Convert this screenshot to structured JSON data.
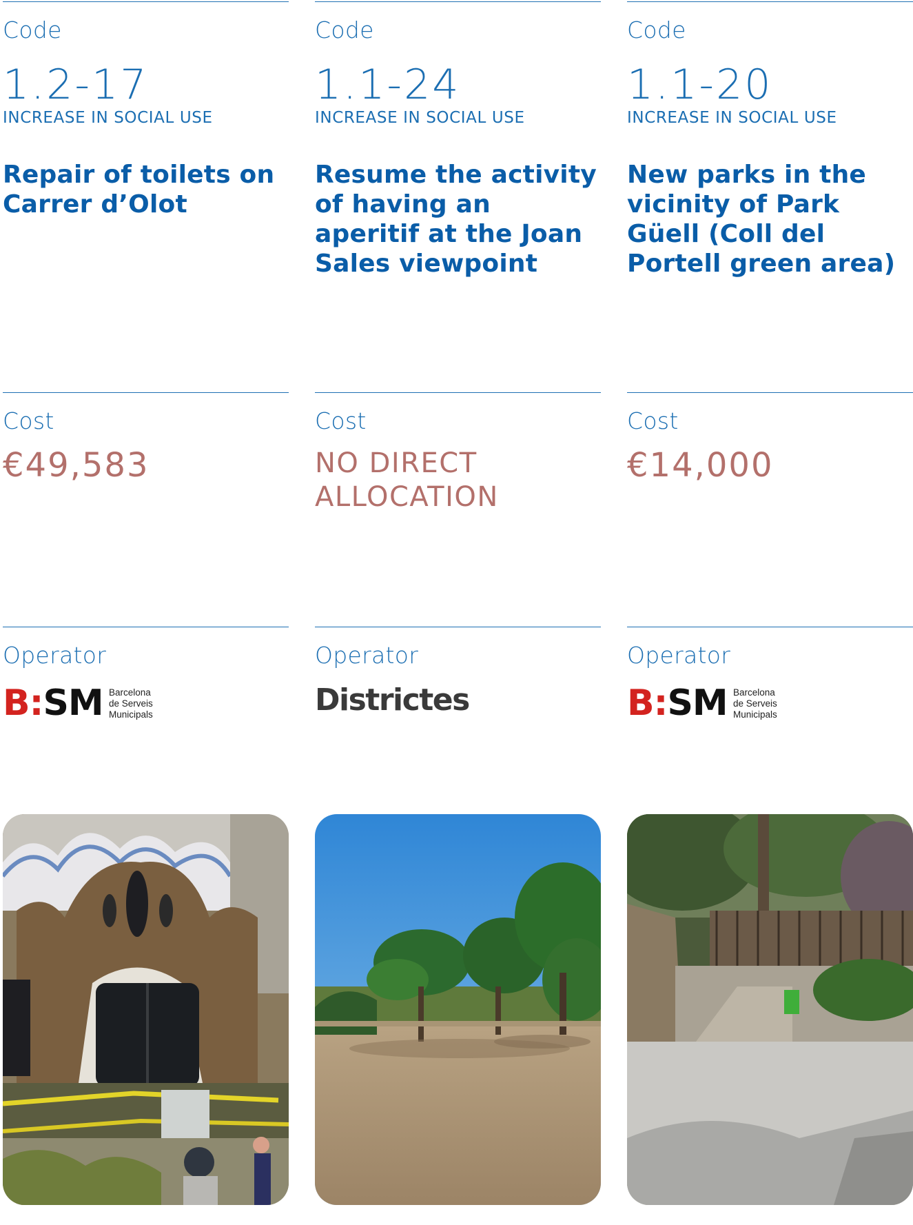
{
  "labels": {
    "code": "Code",
    "cost": "Cost",
    "operator": "Operator"
  },
  "projects": [
    {
      "code": "1.2-17",
      "category": "INCREASE IN SOCIAL USE",
      "title": "Repair of toilets on Carrer d’Olot",
      "cost": "€49,583",
      "operator": {
        "mark_b": "B",
        "mark_colon": ":",
        "mark_sm": "SM",
        "line1": "Barcelona",
        "line2": "de Serveis",
        "line3": "Municipals"
      },
      "photo": "gaudi-pavilion-photo"
    },
    {
      "code": "1.1-24",
      "category": "INCREASE IN SOCIAL USE",
      "title": "Resume the activity of having an aperitif at the Joan Sales viewpoint",
      "cost": "NO DIRECT ALLOCATION",
      "operator": {
        "name": "Districtes"
      },
      "photo": "viewpoint-esplanade-photo"
    },
    {
      "code": "1.1-20",
      "category": "INCREASE IN SOCIAL USE",
      "title": "New parks in the vicinity of Park Güell (Coll del Portell green area)",
      "cost": "€14,000",
      "operator": {
        "mark_b": "B",
        "mark_colon": ":",
        "mark_sm": "SM",
        "line1": "Barcelona",
        "line2": "de Serveis",
        "line3": "Municipals"
      },
      "photo": "green-area-street-photo"
    }
  ],
  "colors": {
    "blue": "#1b6eb2",
    "cost": "#b3706b",
    "bsm_red": "#d3231f"
  }
}
